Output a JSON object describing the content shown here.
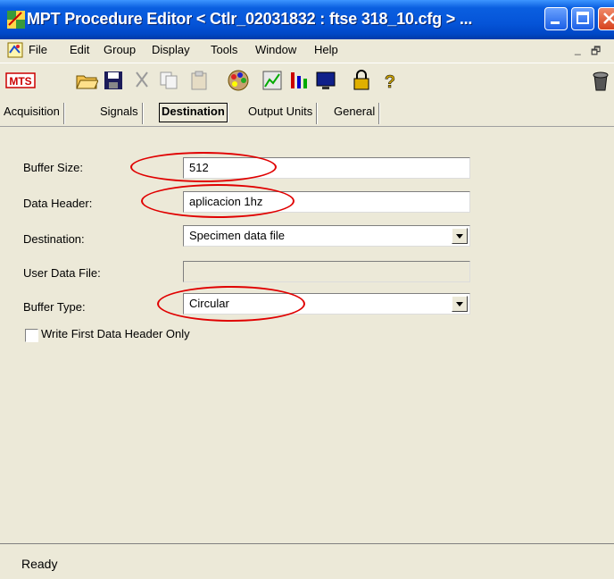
{
  "window": {
    "title": "MPT Procedure Editor  < Ctlr_02031832 : ftse 318_10.cfg >  ..."
  },
  "menu": {
    "items": [
      "File",
      "Edit",
      "Group",
      "Display",
      "Tools",
      "Window",
      "Help"
    ],
    "mdi_controls": [
      "_",
      "🗗"
    ]
  },
  "toolbar": {
    "icons": [
      "mts-logo-icon",
      "open-folder-icon",
      "save-icon",
      "cut-icon",
      "copy-icon",
      "paste-icon",
      "palette-icon",
      "chart-icon",
      "signals-icon",
      "monitor-icon",
      "lock-icon",
      "help-icon",
      "trash-icon"
    ]
  },
  "tabs": [
    "Acquisition",
    "Signals",
    "Destination",
    "Output Units",
    "General"
  ],
  "active_tab": "Destination",
  "form": {
    "buffer_size": {
      "label": "Buffer Size:",
      "value": "512"
    },
    "data_header": {
      "label": "Data Header:",
      "value": "aplicacion 1hz"
    },
    "destination": {
      "label": "Destination:",
      "value": "Specimen data file"
    },
    "user_data_file": {
      "label": "User Data File:",
      "value": ""
    },
    "buffer_type": {
      "label": "Buffer Type:",
      "value": "Circular"
    },
    "write_first_header": {
      "label": "Write First Data Header Only",
      "checked": false
    }
  },
  "status": {
    "text": "Ready"
  },
  "annotation_color": "#e00000",
  "titlebar_color": "#0554d8"
}
